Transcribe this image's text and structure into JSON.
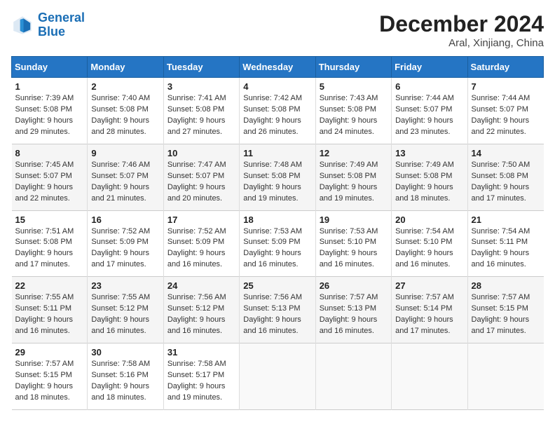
{
  "header": {
    "logo_line1": "General",
    "logo_line2": "Blue",
    "month": "December 2024",
    "location": "Aral, Xinjiang, China"
  },
  "days_of_week": [
    "Sunday",
    "Monday",
    "Tuesday",
    "Wednesday",
    "Thursday",
    "Friday",
    "Saturday"
  ],
  "weeks": [
    [
      {
        "day": 1,
        "lines": [
          "Sunrise: 7:39 AM",
          "Sunset: 5:08 PM",
          "Daylight: 9 hours",
          "and 29 minutes."
        ]
      },
      {
        "day": 2,
        "lines": [
          "Sunrise: 7:40 AM",
          "Sunset: 5:08 PM",
          "Daylight: 9 hours",
          "and 28 minutes."
        ]
      },
      {
        "day": 3,
        "lines": [
          "Sunrise: 7:41 AM",
          "Sunset: 5:08 PM",
          "Daylight: 9 hours",
          "and 27 minutes."
        ]
      },
      {
        "day": 4,
        "lines": [
          "Sunrise: 7:42 AM",
          "Sunset: 5:08 PM",
          "Daylight: 9 hours",
          "and 26 minutes."
        ]
      },
      {
        "day": 5,
        "lines": [
          "Sunrise: 7:43 AM",
          "Sunset: 5:08 PM",
          "Daylight: 9 hours",
          "and 24 minutes."
        ]
      },
      {
        "day": 6,
        "lines": [
          "Sunrise: 7:44 AM",
          "Sunset: 5:07 PM",
          "Daylight: 9 hours",
          "and 23 minutes."
        ]
      },
      {
        "day": 7,
        "lines": [
          "Sunrise: 7:44 AM",
          "Sunset: 5:07 PM",
          "Daylight: 9 hours",
          "and 22 minutes."
        ]
      }
    ],
    [
      {
        "day": 8,
        "lines": [
          "Sunrise: 7:45 AM",
          "Sunset: 5:07 PM",
          "Daylight: 9 hours",
          "and 22 minutes."
        ]
      },
      {
        "day": 9,
        "lines": [
          "Sunrise: 7:46 AM",
          "Sunset: 5:07 PM",
          "Daylight: 9 hours",
          "and 21 minutes."
        ]
      },
      {
        "day": 10,
        "lines": [
          "Sunrise: 7:47 AM",
          "Sunset: 5:07 PM",
          "Daylight: 9 hours",
          "and 20 minutes."
        ]
      },
      {
        "day": 11,
        "lines": [
          "Sunrise: 7:48 AM",
          "Sunset: 5:08 PM",
          "Daylight: 9 hours",
          "and 19 minutes."
        ]
      },
      {
        "day": 12,
        "lines": [
          "Sunrise: 7:49 AM",
          "Sunset: 5:08 PM",
          "Daylight: 9 hours",
          "and 19 minutes."
        ]
      },
      {
        "day": 13,
        "lines": [
          "Sunrise: 7:49 AM",
          "Sunset: 5:08 PM",
          "Daylight: 9 hours",
          "and 18 minutes."
        ]
      },
      {
        "day": 14,
        "lines": [
          "Sunrise: 7:50 AM",
          "Sunset: 5:08 PM",
          "Daylight: 9 hours",
          "and 17 minutes."
        ]
      }
    ],
    [
      {
        "day": 15,
        "lines": [
          "Sunrise: 7:51 AM",
          "Sunset: 5:08 PM",
          "Daylight: 9 hours",
          "and 17 minutes."
        ]
      },
      {
        "day": 16,
        "lines": [
          "Sunrise: 7:52 AM",
          "Sunset: 5:09 PM",
          "Daylight: 9 hours",
          "and 17 minutes."
        ]
      },
      {
        "day": 17,
        "lines": [
          "Sunrise: 7:52 AM",
          "Sunset: 5:09 PM",
          "Daylight: 9 hours",
          "and 16 minutes."
        ]
      },
      {
        "day": 18,
        "lines": [
          "Sunrise: 7:53 AM",
          "Sunset: 5:09 PM",
          "Daylight: 9 hours",
          "and 16 minutes."
        ]
      },
      {
        "day": 19,
        "lines": [
          "Sunrise: 7:53 AM",
          "Sunset: 5:10 PM",
          "Daylight: 9 hours",
          "and 16 minutes."
        ]
      },
      {
        "day": 20,
        "lines": [
          "Sunrise: 7:54 AM",
          "Sunset: 5:10 PM",
          "Daylight: 9 hours",
          "and 16 minutes."
        ]
      },
      {
        "day": 21,
        "lines": [
          "Sunrise: 7:54 AM",
          "Sunset: 5:11 PM",
          "Daylight: 9 hours",
          "and 16 minutes."
        ]
      }
    ],
    [
      {
        "day": 22,
        "lines": [
          "Sunrise: 7:55 AM",
          "Sunset: 5:11 PM",
          "Daylight: 9 hours",
          "and 16 minutes."
        ]
      },
      {
        "day": 23,
        "lines": [
          "Sunrise: 7:55 AM",
          "Sunset: 5:12 PM",
          "Daylight: 9 hours",
          "and 16 minutes."
        ]
      },
      {
        "day": 24,
        "lines": [
          "Sunrise: 7:56 AM",
          "Sunset: 5:12 PM",
          "Daylight: 9 hours",
          "and 16 minutes."
        ]
      },
      {
        "day": 25,
        "lines": [
          "Sunrise: 7:56 AM",
          "Sunset: 5:13 PM",
          "Daylight: 9 hours",
          "and 16 minutes."
        ]
      },
      {
        "day": 26,
        "lines": [
          "Sunrise: 7:57 AM",
          "Sunset: 5:13 PM",
          "Daylight: 9 hours",
          "and 16 minutes."
        ]
      },
      {
        "day": 27,
        "lines": [
          "Sunrise: 7:57 AM",
          "Sunset: 5:14 PM",
          "Daylight: 9 hours",
          "and 17 minutes."
        ]
      },
      {
        "day": 28,
        "lines": [
          "Sunrise: 7:57 AM",
          "Sunset: 5:15 PM",
          "Daylight: 9 hours",
          "and 17 minutes."
        ]
      }
    ],
    [
      {
        "day": 29,
        "lines": [
          "Sunrise: 7:57 AM",
          "Sunset: 5:15 PM",
          "Daylight: 9 hours",
          "and 18 minutes."
        ]
      },
      {
        "day": 30,
        "lines": [
          "Sunrise: 7:58 AM",
          "Sunset: 5:16 PM",
          "Daylight: 9 hours",
          "and 18 minutes."
        ]
      },
      {
        "day": 31,
        "lines": [
          "Sunrise: 7:58 AM",
          "Sunset: 5:17 PM",
          "Daylight: 9 hours",
          "and 19 minutes."
        ]
      },
      null,
      null,
      null,
      null
    ]
  ]
}
